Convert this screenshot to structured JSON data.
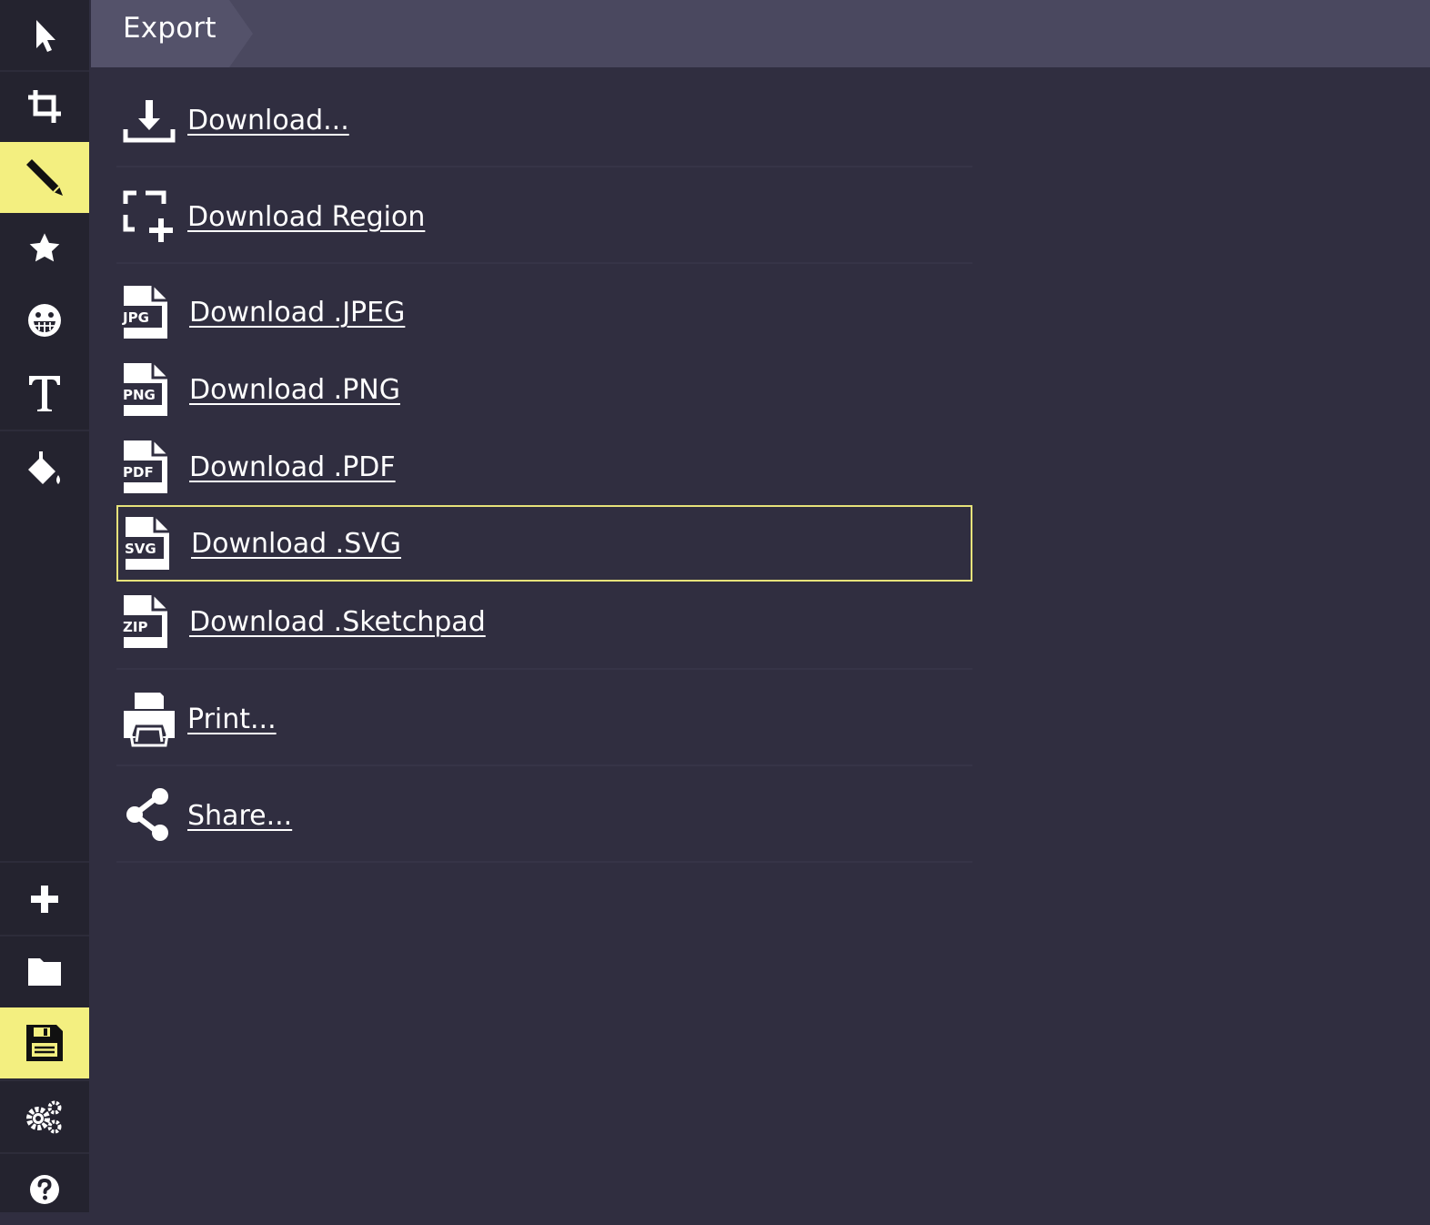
{
  "header": {
    "title": "Export"
  },
  "sidebar": {
    "tools": [
      {
        "name": "select",
        "icon": "cursor-icon"
      },
      {
        "name": "crop",
        "icon": "crop-icon"
      },
      {
        "name": "pencil",
        "icon": "pencil-icon",
        "active": true
      },
      {
        "name": "stamp",
        "icon": "star-icon"
      },
      {
        "name": "emoji",
        "icon": "grin-icon"
      },
      {
        "name": "text",
        "icon": "text-icon"
      },
      {
        "name": "fill",
        "icon": "paint-bucket-icon"
      }
    ],
    "bottom": [
      {
        "name": "new",
        "icon": "plus-icon"
      },
      {
        "name": "open",
        "icon": "folder-icon"
      },
      {
        "name": "save",
        "icon": "save-icon",
        "active": true
      },
      {
        "name": "settings",
        "icon": "gears-icon"
      },
      {
        "name": "help",
        "icon": "help-icon"
      }
    ]
  },
  "menu": {
    "download": "Download...",
    "download_region": "Download Region",
    "jpeg": {
      "label": "Download .JPEG",
      "badge": "JPG"
    },
    "png": {
      "label": "Download .PNG",
      "badge": "PNG"
    },
    "pdf": {
      "label": "Download .PDF",
      "badge": "PDF"
    },
    "svg": {
      "label": "Download .SVG",
      "badge": "SVG"
    },
    "sketchpad": {
      "label": "Download .Sketchpad",
      "badge": "ZIP"
    },
    "print": "Print...",
    "share": "Share..."
  },
  "colors": {
    "accent": "#f3ef80",
    "sidebar_bg": "#24232f",
    "panel_bg": "#302e40",
    "header_bg": "#4a485f",
    "focus_border": "#e6e27a"
  }
}
